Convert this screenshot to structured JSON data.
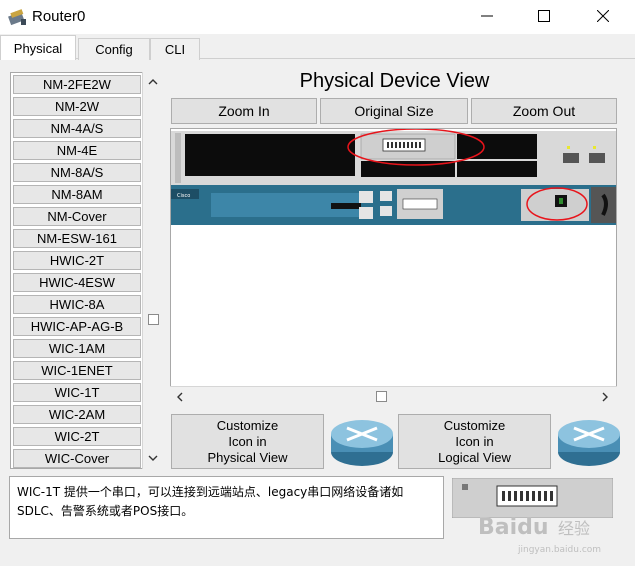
{
  "window": {
    "title": "Router0"
  },
  "tabs": [
    {
      "label": "Physical",
      "active": true
    },
    {
      "label": "Config",
      "active": false
    },
    {
      "label": "CLI",
      "active": false
    }
  ],
  "modules": [
    "NM-2FE2W",
    "NM-2W",
    "NM-4A/S",
    "NM-4E",
    "NM-8A/S",
    "NM-8AM",
    "NM-Cover",
    "NM-ESW-161",
    "HWIC-2T",
    "HWIC-4ESW",
    "HWIC-8A",
    "HWIC-AP-AG-B",
    "WIC-1AM",
    "WIC-1ENET",
    "WIC-1T",
    "WIC-2AM",
    "WIC-2T",
    "WIC-Cover"
  ],
  "view": {
    "title": "Physical Device View",
    "zoom_in": "Zoom In",
    "original_size": "Original Size",
    "zoom_out": "Zoom Out"
  },
  "customize": {
    "physical": [
      "Customize",
      "Icon in",
      "Physical View"
    ],
    "logical": [
      "Customize",
      "Icon in",
      "Logical View"
    ]
  },
  "description": {
    "line1": "WIC-1T 提供一个串口，可以连接到远端站点、legacy串口网络设备诸如",
    "line2": "SDLC、告警系统或者POS接口。"
  },
  "watermark": {
    "brand": "Baidu",
    "sub": "经验",
    "url": "jingyan.baidu.com"
  },
  "colors": {
    "annotation": "#e8141b",
    "router_body": "#2b6f8c",
    "router_icon": "#4a8fb5"
  }
}
